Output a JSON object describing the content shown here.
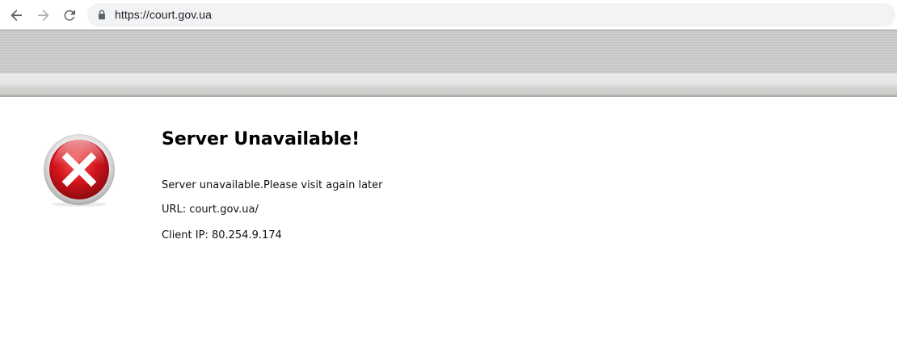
{
  "browser": {
    "url": "https://court.gov.ua",
    "icons": {
      "back": "back-arrow-icon",
      "forward": "forward-arrow-icon",
      "reload": "reload-icon",
      "secure": "lock-icon"
    }
  },
  "page": {
    "title": "Server Unavailable!",
    "message": "Server unavailable.Please visit again later",
    "url_line": "URL: court.gov.ua/",
    "client_ip_line": "Client IP: 80.254.9.174",
    "icon": "error-x-icon",
    "colors": {
      "error_red": "#d4141c",
      "banner_grey": "#c9cbc8"
    }
  }
}
